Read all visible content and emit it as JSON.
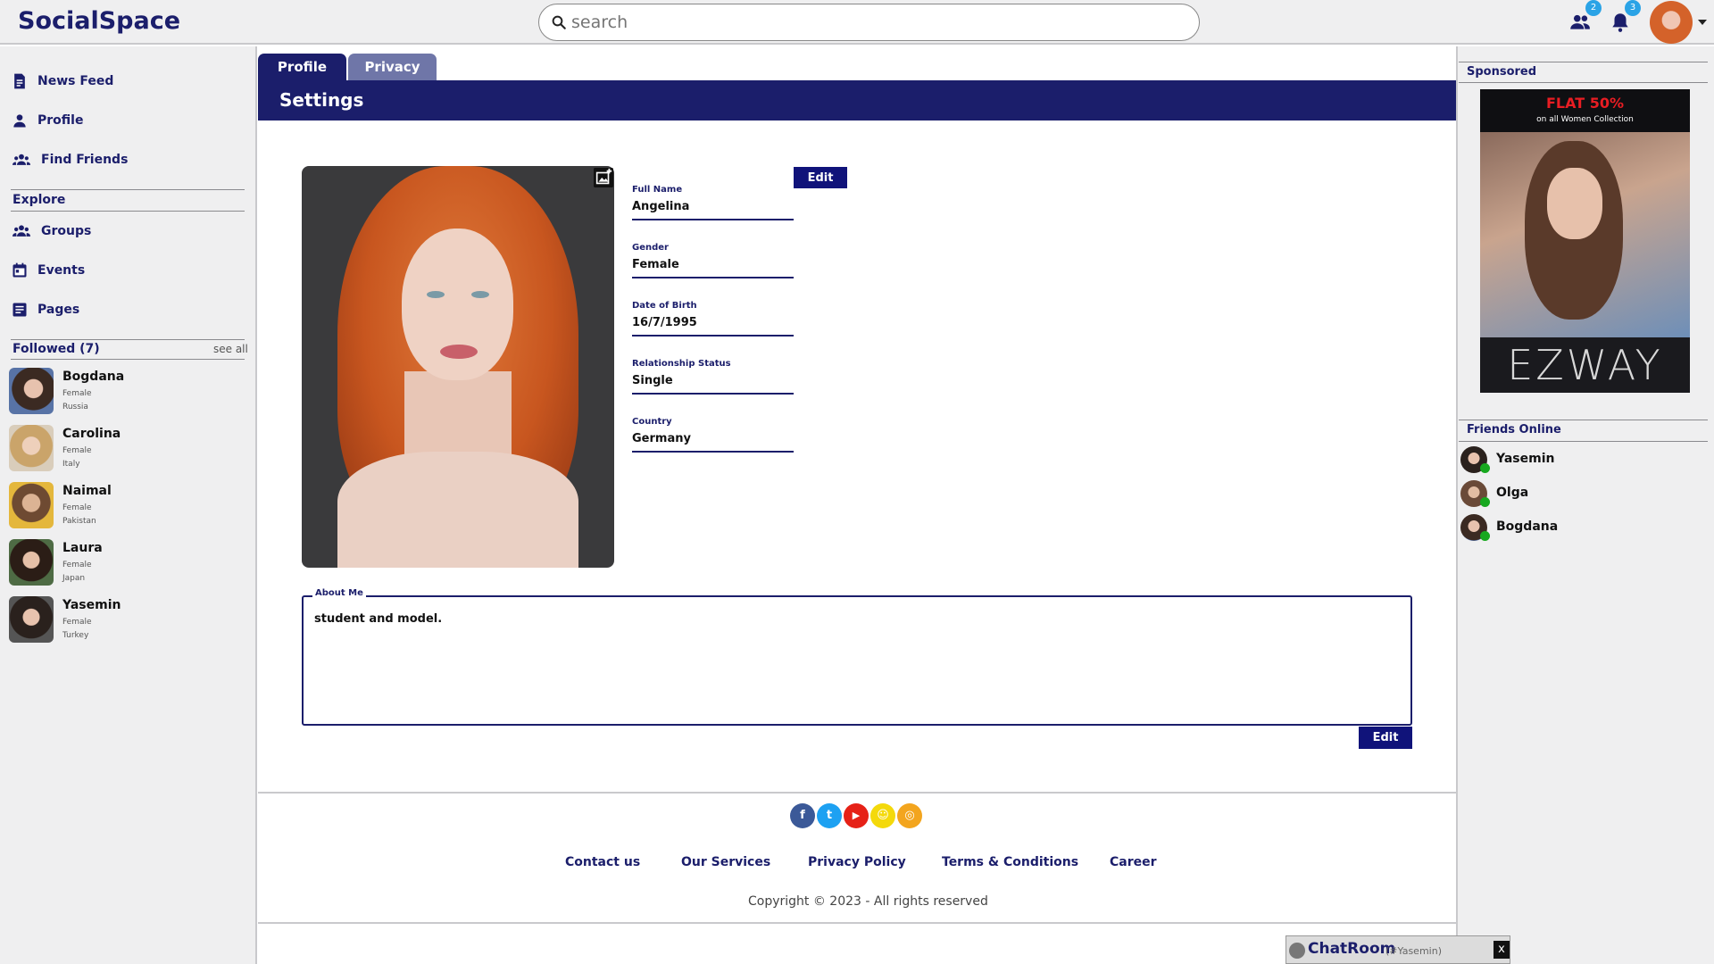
{
  "app": {
    "logo": "SocialSpace"
  },
  "search": {
    "placeholder": "search"
  },
  "topbar": {
    "friend_requests_count": "2",
    "notifications_count": "3"
  },
  "sidebar": {
    "nav": [
      {
        "label": "News Feed",
        "icon": "news-feed-icon"
      },
      {
        "label": "Profile",
        "icon": "person-icon"
      },
      {
        "label": "Find Friends",
        "icon": "find-friends-icon"
      }
    ],
    "explore_heading": "Explore",
    "explore": [
      {
        "label": "Groups",
        "icon": "groups-icon"
      },
      {
        "label": "Events",
        "icon": "calendar-icon"
      },
      {
        "label": "Pages",
        "icon": "pages-icon"
      }
    ],
    "followed_heading": "Followed (7)",
    "see_all": "see all",
    "followed": [
      {
        "name": "Bogdana",
        "gender": "Female",
        "country": "Russia"
      },
      {
        "name": "Carolina",
        "gender": "Female",
        "country": "Italy"
      },
      {
        "name": "Naimal",
        "gender": "Female",
        "country": "Pakistan"
      },
      {
        "name": "Laura",
        "gender": "Female",
        "country": "Japan"
      },
      {
        "name": "Yasemin",
        "gender": "Female",
        "country": "Turkey"
      }
    ]
  },
  "tabs": [
    {
      "label": "Profile",
      "active": true
    },
    {
      "label": "Privacy",
      "active": false
    }
  ],
  "settings_title": "Settings",
  "profile": {
    "edit_label": "Edit",
    "fields": [
      {
        "label": "Full Name",
        "value": "Angelina"
      },
      {
        "label": "Gender",
        "value": "Female"
      },
      {
        "label": "Date of Birth",
        "value": "16/7/1995"
      },
      {
        "label": "Relationship Status",
        "value": "Single"
      },
      {
        "label": "Country",
        "value": "Germany"
      }
    ],
    "about_label": "About Me",
    "about_text": "student and model.",
    "about_edit_label": "Edit"
  },
  "footer": {
    "social": [
      {
        "icon": "facebook-icon",
        "glyph": "f",
        "color": "#3b5998"
      },
      {
        "icon": "twitter-icon",
        "glyph": "t",
        "color": "#1da1f2"
      },
      {
        "icon": "youtube-icon",
        "glyph": "▶",
        "color": "#e62117"
      },
      {
        "icon": "snapchat-icon",
        "glyph": "☺",
        "color": "#f4d90b"
      },
      {
        "icon": "instagram-icon",
        "glyph": "◎",
        "color": "#f3a51e"
      }
    ],
    "links": [
      "Contact us",
      "Our Services",
      "Privacy Policy",
      "Terms & Conditions",
      "Career"
    ],
    "copyright": "Copyright © 2023 - All rights reserved"
  },
  "right": {
    "sponsored_heading": "Sponsored",
    "ad": {
      "headline": "FLAT 50%",
      "subline": "on all Women Collection",
      "brand": "EZWAY"
    },
    "friends_online_heading": "Friends Online",
    "friends_online": [
      {
        "name": "Yasemin"
      },
      {
        "name": "Olga"
      },
      {
        "name": "Bogdana"
      }
    ]
  },
  "chat": {
    "title": "ChatRoom",
    "room": "(#Yasemin)",
    "close": "x"
  },
  "colors": {
    "brand": "#1b1e6b",
    "tab_inactive": "#6f76a8",
    "online": "#17a81f",
    "badge": "#2aa3e6"
  }
}
